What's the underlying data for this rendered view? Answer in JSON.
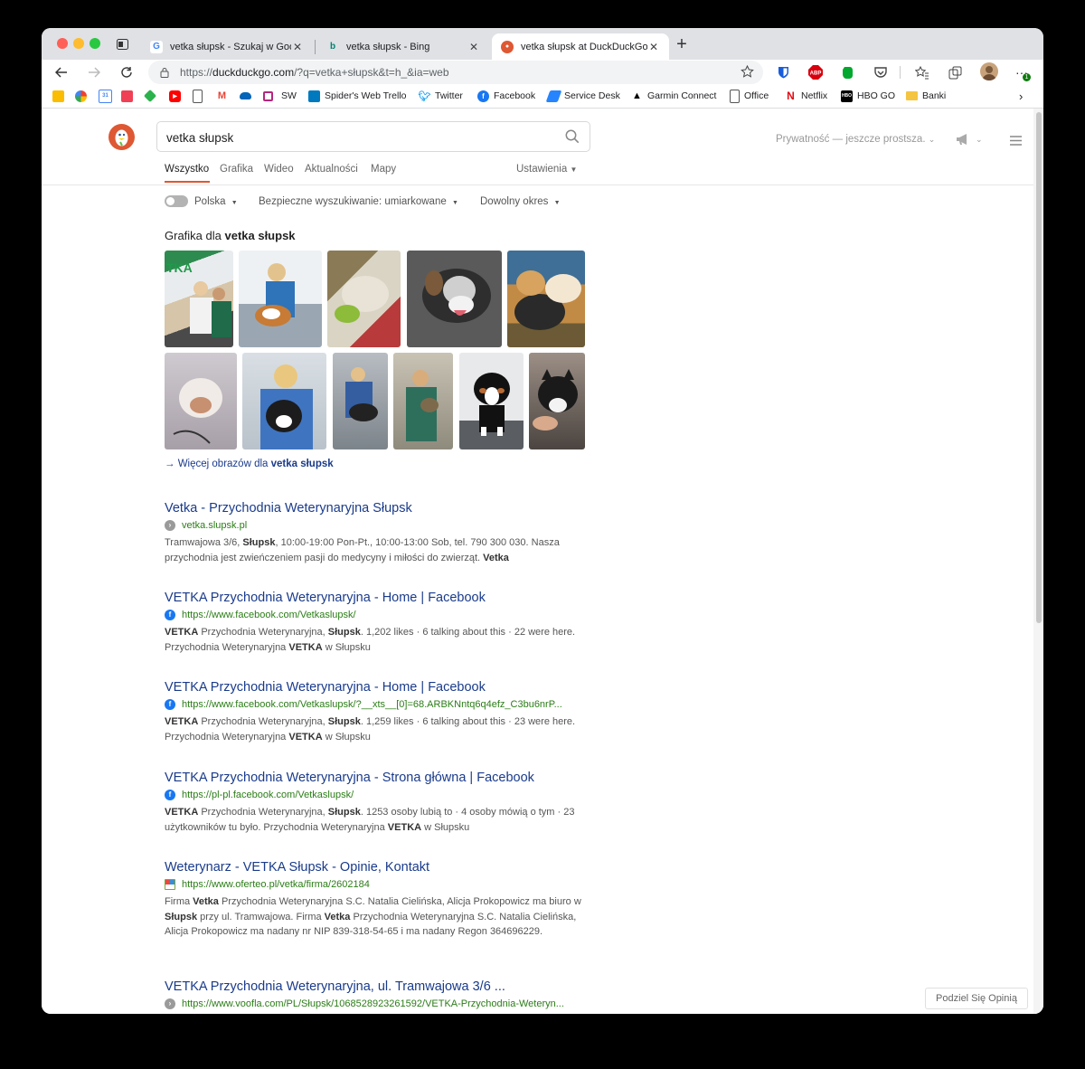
{
  "tabs": [
    {
      "title": "vetka słupsk - Szukaj w Googl",
      "favicon": "google-icon"
    },
    {
      "title": "vetka słupsk - Bing",
      "favicon": "bing-icon"
    },
    {
      "title": "vetka słupsk at DuckDuckGo",
      "favicon": "duckduckgo-icon",
      "active": true
    }
  ],
  "url": {
    "prefix": "https://",
    "domain": "duckduckgo.com",
    "path": "/?q=vetka+słupsk&t=h_&ia=web"
  },
  "extensions": {
    "abp_label": "ABP",
    "notification_count": "1"
  },
  "bookmarks": [
    {
      "label": "",
      "icon": "notes-icon"
    },
    {
      "label": "",
      "icon": "pinwheel-icon"
    },
    {
      "label": "",
      "icon": "calendar-icon"
    },
    {
      "label": "",
      "icon": "pocket-icon"
    },
    {
      "label": "",
      "icon": "feedly-icon"
    },
    {
      "label": "",
      "icon": "youtube-icon"
    },
    {
      "label": "",
      "icon": "document-icon"
    },
    {
      "label": "",
      "icon": "gmail-icon"
    },
    {
      "label": "",
      "icon": "onedrive-icon"
    },
    {
      "label": "",
      "icon": "square-icon"
    },
    {
      "label": "SW",
      "icon": "sw-icon"
    },
    {
      "label": "Spider's Web Trello",
      "icon": "trello-icon"
    },
    {
      "label": "Twitter",
      "icon": "twitter-icon"
    },
    {
      "label": "Facebook",
      "icon": "facebook-icon"
    },
    {
      "label": "Service Desk",
      "icon": "jira-icon"
    },
    {
      "label": "Garmin Connect",
      "icon": "garmin-icon"
    },
    {
      "label": "Office",
      "icon": "document-icon"
    },
    {
      "label": "Netflix",
      "icon": "netflix-icon"
    },
    {
      "label": "HBO GO",
      "icon": "hbo-icon"
    },
    {
      "label": "Banki",
      "icon": "folder-icon"
    }
  ],
  "search": {
    "query": "vetka słupsk"
  },
  "nav_tabs": [
    "Wszystko",
    "Grafika",
    "Wideo",
    "Aktualności",
    "Mapy"
  ],
  "settings_label": "Ustawienia",
  "privacy_label": "Prywatność — jeszcze prostsza.",
  "filters": {
    "region": "Polska",
    "safe_search": "Bezpieczne wyszukiwanie: umiarkowane",
    "time": "Dowolny okres"
  },
  "images_section": {
    "prefix": "Grafika dla ",
    "query": "vetka słupsk",
    "more_prefix": "Więcej obrazów dla ",
    "more_query": "vetka słupsk"
  },
  "results": [
    {
      "title": "Vetka - Przychodnia Weterynaryjna Słupsk",
      "url": "vetka.slupsk.pl",
      "icon": "globe-icon",
      "snippet": [
        {
          "t": "Tramwajowa 3/6, "
        },
        {
          "t": "Słupsk",
          "b": true
        },
        {
          "t": ", 10:00-19:00 Pon-Pt., 10:00-13:00 Sob, tel. 790 300 030. Nasza przychodnia jest zwieńczeniem pasji do medycyny i miłości do zwierząt. "
        },
        {
          "t": "Vetka",
          "b": true
        }
      ]
    },
    {
      "title": "VETKA Przychodnia Weterynaryjna - Home | Facebook",
      "url": "https://www.facebook.com/Vetkaslupsk/",
      "icon": "facebook-icon",
      "snippet": [
        {
          "t": "VETKA",
          "b": true
        },
        {
          "t": " Przychodnia Weterynaryjna, "
        },
        {
          "t": "Słupsk",
          "b": true
        },
        {
          "t": ". 1,202 likes · 6 talking about this · 22 were here. Przychodnia Weterynaryjna "
        },
        {
          "t": "VETKA",
          "b": true
        },
        {
          "t": " w Słupsku"
        }
      ]
    },
    {
      "title": "VETKA Przychodnia Weterynaryjna - Home | Facebook",
      "url": "https://www.facebook.com/Vetkaslupsk/?__xts__[0]=68.ARBKNntq6q4efz_C3bu6nrP...",
      "icon": "facebook-icon",
      "snippet": [
        {
          "t": "VETKA",
          "b": true
        },
        {
          "t": " Przychodnia Weterynaryjna, "
        },
        {
          "t": "Słupsk",
          "b": true
        },
        {
          "t": ". 1,259 likes · 6 talking about this · 23 were here. Przychodnia Weterynaryjna "
        },
        {
          "t": "VETKA",
          "b": true
        },
        {
          "t": " w Słupsku"
        }
      ]
    },
    {
      "title": "VETKA Przychodnia Weterynaryjna - Strona główna | Facebook",
      "url": "https://pl-pl.facebook.com/Vetkaslupsk/",
      "icon": "facebook-icon",
      "snippet": [
        {
          "t": "VETKA",
          "b": true
        },
        {
          "t": " Przychodnia Weterynaryjna, "
        },
        {
          "t": "Słupsk",
          "b": true
        },
        {
          "t": ". 1253 osoby lubią to · 4 osoby mówią o tym · 23 użytkowników tu było. Przychodnia Weterynaryjna "
        },
        {
          "t": "VETKA",
          "b": true
        },
        {
          "t": " w Słupsku"
        }
      ]
    },
    {
      "title": "Weterynarz - VETKA Słupsk - Opinie, Kontakt",
      "url": "https://www.oferteo.pl/vetka/firma/2602184",
      "icon": "oferteo-icon",
      "snippet": [
        {
          "t": "Firma "
        },
        {
          "t": "Vetka",
          "b": true
        },
        {
          "t": " Przychodnia Weterynaryjna S.C. Natalia Cielińska, Alicja Prokopowicz ma biuro w "
        },
        {
          "t": "Słupsk",
          "b": true
        },
        {
          "t": " przy ul. Tramwajowa. Firma "
        },
        {
          "t": "Vetka",
          "b": true
        },
        {
          "t": " Przychodnia Weterynaryjna S.C. Natalia Cielińska, Alicja Prokopowicz ma nadany nr NIP 839-318-54-65 i ma nadany Regon 364696229."
        }
      ]
    },
    {
      "title": "VETKA Przychodnia Weterynaryjna, ul. Tramwajowa 3/6 ...",
      "url": "https://www.voofla.com/PL/Słupsk/1068528923261592/VETKA-Przychodnia-Weteryn...",
      "icon": "globe-icon",
      "snippet": []
    }
  ],
  "feedback_label": "Podziel Się Opinią"
}
